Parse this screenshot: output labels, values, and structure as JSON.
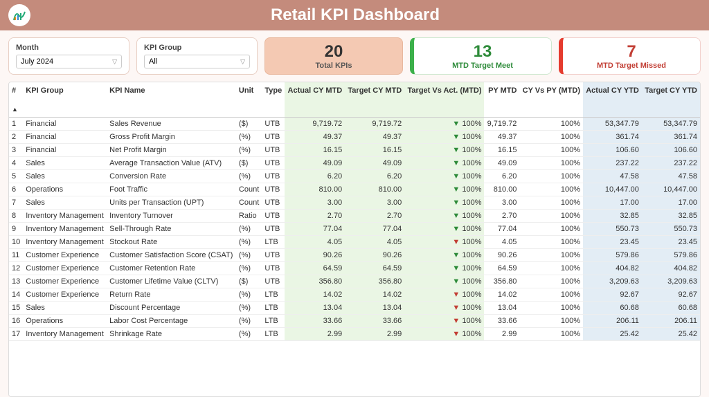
{
  "header": {
    "title": "Retail KPI Dashboard"
  },
  "filters": {
    "month": {
      "label": "Month",
      "value": "July 2024"
    },
    "group": {
      "label": "KPI Group",
      "value": "All"
    }
  },
  "metrics": {
    "total": {
      "value": "20",
      "label": "Total KPIs"
    },
    "meet": {
      "value": "13",
      "label": "MTD Target Meet"
    },
    "miss": {
      "value": "7",
      "label": "MTD Target Missed"
    }
  },
  "columns": {
    "idx": "#",
    "group": "KPI Group",
    "name": "KPI Name",
    "unit": "Unit",
    "type": "Type",
    "act_mtd": "Actual CY MTD",
    "tgt_mtd": "Target CY MTD",
    "tva": "Target Vs Act. (MTD)",
    "py_mtd": "PY MTD",
    "cv": "CY Vs PY (MTD)",
    "act_ytd": "Actual CY YTD",
    "tgt_ytd": "Target CY YTD"
  },
  "rows": [
    {
      "i": "1",
      "g": "Financial",
      "n": "Sales Revenue",
      "u": "($)",
      "t": "UTB",
      "am": "9,719.72",
      "tm": "9,719.72",
      "dir": "dn",
      "tva": "100%",
      "py": "9,719.72",
      "cv": "100%",
      "ay": "53,347.79",
      "ty": "53,347.79"
    },
    {
      "i": "2",
      "g": "Financial",
      "n": "Gross Profit Margin",
      "u": "(%)",
      "t": "UTB",
      "am": "49.37",
      "tm": "49.37",
      "dir": "dn",
      "tva": "100%",
      "py": "49.37",
      "cv": "100%",
      "ay": "361.74",
      "ty": "361.74"
    },
    {
      "i": "3",
      "g": "Financial",
      "n": "Net Profit Margin",
      "u": "(%)",
      "t": "UTB",
      "am": "16.15",
      "tm": "16.15",
      "dir": "dn",
      "tva": "100%",
      "py": "16.15",
      "cv": "100%",
      "ay": "106.60",
      "ty": "106.60"
    },
    {
      "i": "4",
      "g": "Sales",
      "n": "Average Transaction Value (ATV)",
      "u": "($)",
      "t": "UTB",
      "am": "49.09",
      "tm": "49.09",
      "dir": "dn",
      "tva": "100%",
      "py": "49.09",
      "cv": "100%",
      "ay": "237.22",
      "ty": "237.22"
    },
    {
      "i": "5",
      "g": "Sales",
      "n": "Conversion Rate",
      "u": "(%)",
      "t": "UTB",
      "am": "6.20",
      "tm": "6.20",
      "dir": "dn",
      "tva": "100%",
      "py": "6.20",
      "cv": "100%",
      "ay": "47.58",
      "ty": "47.58"
    },
    {
      "i": "6",
      "g": "Operations",
      "n": "Foot Traffic",
      "u": "Count",
      "t": "UTB",
      "am": "810.00",
      "tm": "810.00",
      "dir": "dn",
      "tva": "100%",
      "py": "810.00",
      "cv": "100%",
      "ay": "10,447.00",
      "ty": "10,447.00"
    },
    {
      "i": "7",
      "g": "Sales",
      "n": "Units per Transaction (UPT)",
      "u": "Count",
      "t": "UTB",
      "am": "3.00",
      "tm": "3.00",
      "dir": "dn",
      "tva": "100%",
      "py": "3.00",
      "cv": "100%",
      "ay": "17.00",
      "ty": "17.00"
    },
    {
      "i": "8",
      "g": "Inventory Management",
      "n": "Inventory Turnover",
      "u": "Ratio",
      "t": "UTB",
      "am": "2.70",
      "tm": "2.70",
      "dir": "dn",
      "tva": "100%",
      "py": "2.70",
      "cv": "100%",
      "ay": "32.85",
      "ty": "32.85"
    },
    {
      "i": "9",
      "g": "Inventory Management",
      "n": "Sell-Through Rate",
      "u": "(%)",
      "t": "UTB",
      "am": "77.04",
      "tm": "77.04",
      "dir": "dn",
      "tva": "100%",
      "py": "77.04",
      "cv": "100%",
      "ay": "550.73",
      "ty": "550.73"
    },
    {
      "i": "10",
      "g": "Inventory Management",
      "n": "Stockout Rate",
      "u": "(%)",
      "t": "LTB",
      "am": "4.05",
      "tm": "4.05",
      "dir": "up",
      "tva": "100%",
      "py": "4.05",
      "cv": "100%",
      "ay": "23.45",
      "ty": "23.45"
    },
    {
      "i": "11",
      "g": "Customer Experience",
      "n": "Customer Satisfaction Score (CSAT)",
      "u": "(%)",
      "t": "UTB",
      "am": "90.26",
      "tm": "90.26",
      "dir": "dn",
      "tva": "100%",
      "py": "90.26",
      "cv": "100%",
      "ay": "579.86",
      "ty": "579.86"
    },
    {
      "i": "12",
      "g": "Customer Experience",
      "n": "Customer Retention Rate",
      "u": "(%)",
      "t": "UTB",
      "am": "64.59",
      "tm": "64.59",
      "dir": "dn",
      "tva": "100%",
      "py": "64.59",
      "cv": "100%",
      "ay": "404.82",
      "ty": "404.82"
    },
    {
      "i": "13",
      "g": "Customer Experience",
      "n": "Customer Lifetime Value (CLTV)",
      "u": "($)",
      "t": "UTB",
      "am": "356.80",
      "tm": "356.80",
      "dir": "dn",
      "tva": "100%",
      "py": "356.80",
      "cv": "100%",
      "ay": "3,209.63",
      "ty": "3,209.63"
    },
    {
      "i": "14",
      "g": "Customer Experience",
      "n": "Return Rate",
      "u": "(%)",
      "t": "LTB",
      "am": "14.02",
      "tm": "14.02",
      "dir": "up",
      "tva": "100%",
      "py": "14.02",
      "cv": "100%",
      "ay": "92.67",
      "ty": "92.67"
    },
    {
      "i": "15",
      "g": "Sales",
      "n": "Discount Percentage",
      "u": "(%)",
      "t": "LTB",
      "am": "13.04",
      "tm": "13.04",
      "dir": "up",
      "tva": "100%",
      "py": "13.04",
      "cv": "100%",
      "ay": "60.68",
      "ty": "60.68"
    },
    {
      "i": "16",
      "g": "Operations",
      "n": "Labor Cost Percentage",
      "u": "(%)",
      "t": "LTB",
      "am": "33.66",
      "tm": "33.66",
      "dir": "up",
      "tva": "100%",
      "py": "33.66",
      "cv": "100%",
      "ay": "206.11",
      "ty": "206.11"
    },
    {
      "i": "17",
      "g": "Inventory Management",
      "n": "Shrinkage Rate",
      "u": "(%)",
      "t": "LTB",
      "am": "2.99",
      "tm": "2.99",
      "dir": "up",
      "tva": "100%",
      "py": "2.99",
      "cv": "100%",
      "ay": "25.42",
      "ty": "25.42"
    }
  ]
}
